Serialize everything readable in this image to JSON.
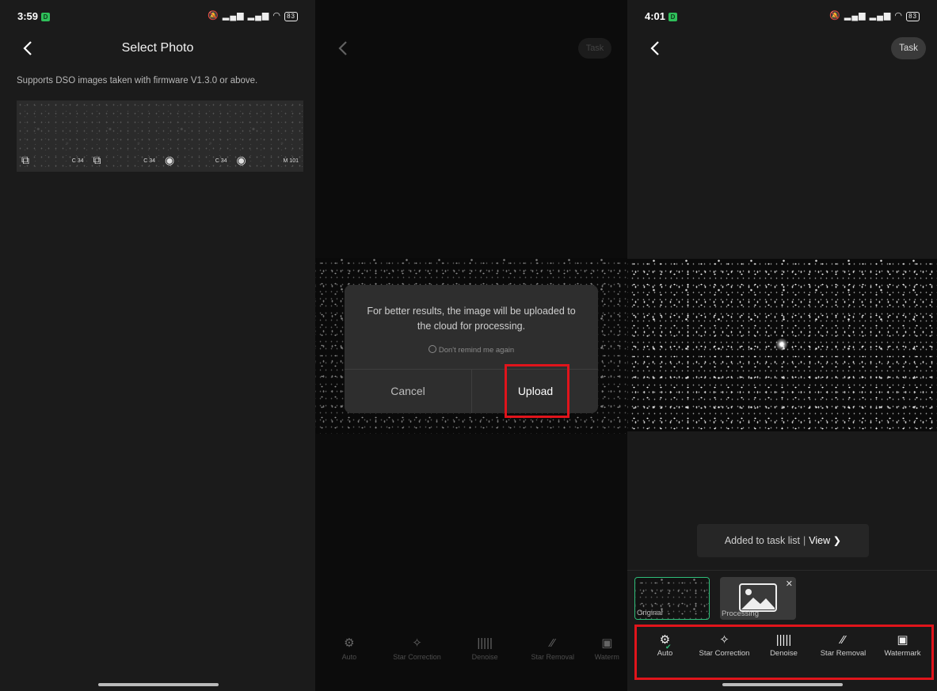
{
  "panel1": {
    "status": {
      "time": "3:59",
      "badge": "D",
      "battery": "83"
    },
    "title": "Select Photo",
    "subtitle": "Supports DSO images taken with firmware V1.3.0 or above.",
    "thumbnails": [
      {
        "label": "C 34",
        "icon": "stack-icon"
      },
      {
        "label": "C 34",
        "icon": "stack-icon"
      },
      {
        "label": "C 34",
        "icon": "target-icon"
      },
      {
        "label": "M 101",
        "icon": "target-icon"
      }
    ]
  },
  "panel2": {
    "task_label": "Task",
    "dialog": {
      "message": "For better results, the image will be uploaded to the cloud for processing.",
      "remind": "Don't remind me again",
      "cancel": "Cancel",
      "upload": "Upload"
    },
    "tools": [
      {
        "label": "Auto",
        "icon": "gear-icon"
      },
      {
        "label": "Star Correction",
        "icon": "sparkle-icon"
      },
      {
        "label": "Denoise",
        "icon": "waveform-icon"
      },
      {
        "label": "Star Removal",
        "icon": "wand-icon"
      },
      {
        "label": "Waterm",
        "icon": "image-icon"
      }
    ]
  },
  "panel3": {
    "status": {
      "time": "4:01",
      "badge": "D",
      "battery": "83"
    },
    "task_label": "Task",
    "toast": {
      "text": "Added to task list",
      "separator": "|",
      "action": "View"
    },
    "versions": {
      "original": "Original",
      "processing": "Processing"
    },
    "tools": [
      {
        "label": "Auto",
        "icon": "gear-icon",
        "selected": true
      },
      {
        "label": "Star Correction",
        "icon": "sparkle-icon"
      },
      {
        "label": "Denoise",
        "icon": "waveform-icon"
      },
      {
        "label": "Star Removal",
        "icon": "wand-icon"
      },
      {
        "label": "Watermark",
        "icon": "image-icon"
      }
    ]
  },
  "colors": {
    "highlight": "#e0141b",
    "accent": "#2fbf7a"
  }
}
